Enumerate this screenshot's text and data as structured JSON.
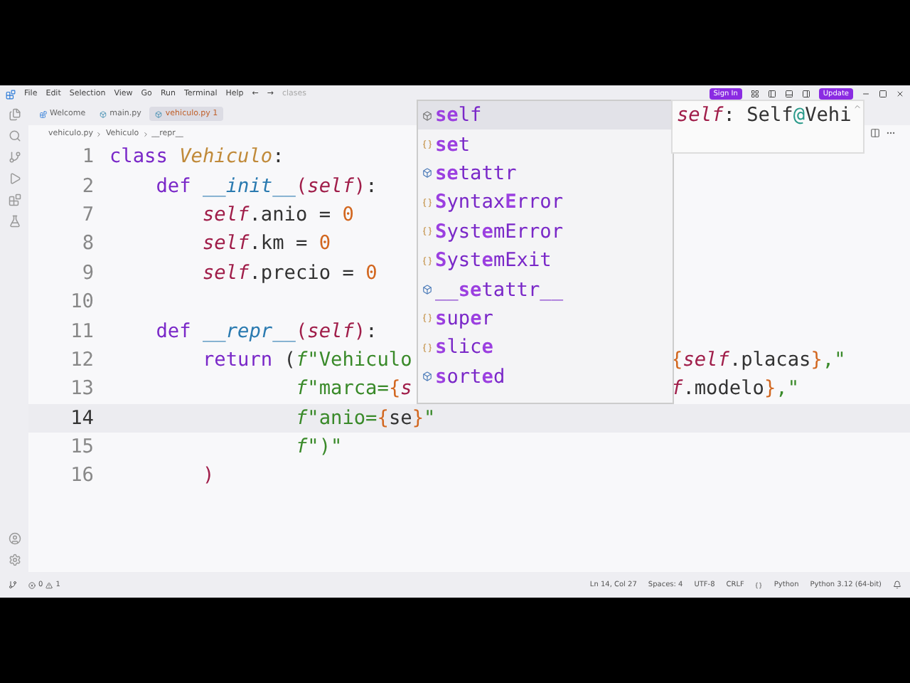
{
  "title_bar": {
    "menus": [
      "File",
      "Edit",
      "Selection",
      "View",
      "Go",
      "Run",
      "Terminal",
      "Help"
    ],
    "back": "←",
    "forward": "→",
    "search": "clases",
    "sign_in": "Sign In",
    "update": "Update"
  },
  "tabs": [
    {
      "label": "Welcome",
      "kind": "welcome",
      "selected": false
    },
    {
      "label": "main.py",
      "kind": "python",
      "selected": false
    },
    {
      "label": "vehiculo.py",
      "problems": "1",
      "kind": "python",
      "selected": true
    }
  ],
  "breadcrumb": [
    "vehiculo.py",
    "Vehiculo",
    "__repr__"
  ],
  "lines": [
    {
      "number": "1",
      "current": false,
      "tokens": [
        {
          "kind": "keyword",
          "text": "class "
        },
        {
          "kind": "classname",
          "text": "Vehiculo"
        },
        {
          "kind": "plain",
          "text": ":"
        }
      ]
    },
    {
      "number": "2",
      "current": false,
      "tokens": [
        {
          "kind": "keyword",
          "text": "    def "
        },
        {
          "kind": "fn",
          "text": "__init__"
        },
        {
          "kind": "paren",
          "text": "("
        },
        {
          "kind": "self",
          "text": "self"
        },
        {
          "kind": "paren",
          "text": ")"
        },
        {
          "kind": "plain",
          "text": ":"
        }
      ]
    },
    {
      "number": "7",
      "current": false,
      "tokens": [
        {
          "kind": "self",
          "text": "        self"
        },
        {
          "kind": "plain",
          "text": ".anio = "
        },
        {
          "kind": "num",
          "text": "0"
        }
      ]
    },
    {
      "number": "8",
      "current": false,
      "tokens": [
        {
          "kind": "self",
          "text": "        self"
        },
        {
          "kind": "plain",
          "text": ".km = "
        },
        {
          "kind": "num",
          "text": "0"
        }
      ]
    },
    {
      "number": "9",
      "current": false,
      "tokens": [
        {
          "kind": "self",
          "text": "        self"
        },
        {
          "kind": "plain",
          "text": ".precio = "
        },
        {
          "kind": "num",
          "text": "0"
        }
      ]
    },
    {
      "number": "10",
      "current": false
    },
    {
      "number": "11",
      "current": false,
      "tokens": [
        {
          "kind": "keyword",
          "text": "    def "
        },
        {
          "kind": "fn",
          "text": "__repr__"
        },
        {
          "kind": "paren",
          "text": "("
        },
        {
          "kind": "self",
          "text": "self"
        },
        {
          "kind": "paren",
          "text": ")"
        },
        {
          "kind": "plain",
          "text": ":"
        }
      ]
    },
    {
      "number": "12",
      "current": false,
      "tokens": [
        {
          "kind": "keyword",
          "text": "        return "
        },
        {
          "kind": "plain",
          "text": "("
        },
        {
          "kind": "fprefix",
          "text": "f"
        },
        {
          "kind": "str",
          "text": "\"Vehiculo"
        }
      ],
      "right": [
        {
          "kind": "brace",
          "text": "{"
        },
        {
          "kind": "self",
          "text": "self"
        },
        {
          "kind": "plain",
          "text": ".placas"
        },
        {
          "kind": "brace",
          "text": "}"
        },
        {
          "kind": "str",
          "text": ",\""
        }
      ]
    },
    {
      "number": "13",
      "current": false,
      "tokens": [
        {
          "kind": "fprefix",
          "text": "                f"
        },
        {
          "kind": "str",
          "text": "\"marca="
        },
        {
          "kind": "brace",
          "text": "{"
        },
        {
          "kind": "self",
          "text": "s"
        }
      ],
      "right": [
        {
          "kind": "self",
          "text": "f"
        },
        {
          "kind": "plain",
          "text": ".modelo"
        },
        {
          "kind": "brace",
          "text": "}"
        },
        {
          "kind": "str",
          "text": ",\""
        }
      ]
    },
    {
      "number": "14",
      "current": true,
      "tokens": [
        {
          "kind": "fprefix",
          "text": "                f"
        },
        {
          "kind": "str",
          "text": "\"anio="
        },
        {
          "kind": "brace",
          "text": "{"
        },
        {
          "kind": "plain",
          "text": "se"
        },
        {
          "kind": "brace",
          "text": "}"
        },
        {
          "kind": "str",
          "text": "\""
        }
      ]
    },
    {
      "number": "15",
      "current": false,
      "tokens": [
        {
          "kind": "fprefix",
          "text": "                f"
        },
        {
          "kind": "str",
          "text": "\")\""
        }
      ]
    },
    {
      "number": "16",
      "current": false,
      "tokens": [
        {
          "kind": "paren",
          "text": "        )"
        }
      ]
    }
  ],
  "suggestions": [
    {
      "label": "**se**lf",
      "kind": "variable",
      "selected": true
    },
    {
      "label": "**se**t",
      "kind": "class",
      "selected": false
    },
    {
      "label": "**se**tattr",
      "kind": "function",
      "selected": false
    },
    {
      "label": "**S**yntax**E**rror",
      "kind": "class",
      "selected": false
    },
    {
      "label": "**S**yst**e**mError",
      "kind": "class",
      "selected": false
    },
    {
      "label": "**S**yst**e**mExit",
      "kind": "class",
      "selected": false
    },
    {
      "label": "__**se**tattr__",
      "kind": "function",
      "selected": false
    },
    {
      "label": "**s**up**e**r",
      "kind": "class",
      "selected": false
    },
    {
      "label": "**s**lic**e**",
      "kind": "class",
      "selected": false
    },
    {
      "label": "**s**ort**e**d",
      "kind": "function",
      "selected": false
    }
  ],
  "hover": {
    "name": "self",
    "separator": ":",
    "type": "Self",
    "at": "@",
    "rest": "Vehi"
  },
  "status_bar": {
    "errors": "0",
    "warnings": "1",
    "position": "Ln 14, Col 27",
    "spaces": "Spaces: 4",
    "encoding": "UTF-8",
    "eol": "CRLF",
    "language": "Python",
    "interpreter": "Python 3.12 (64-bit)"
  }
}
